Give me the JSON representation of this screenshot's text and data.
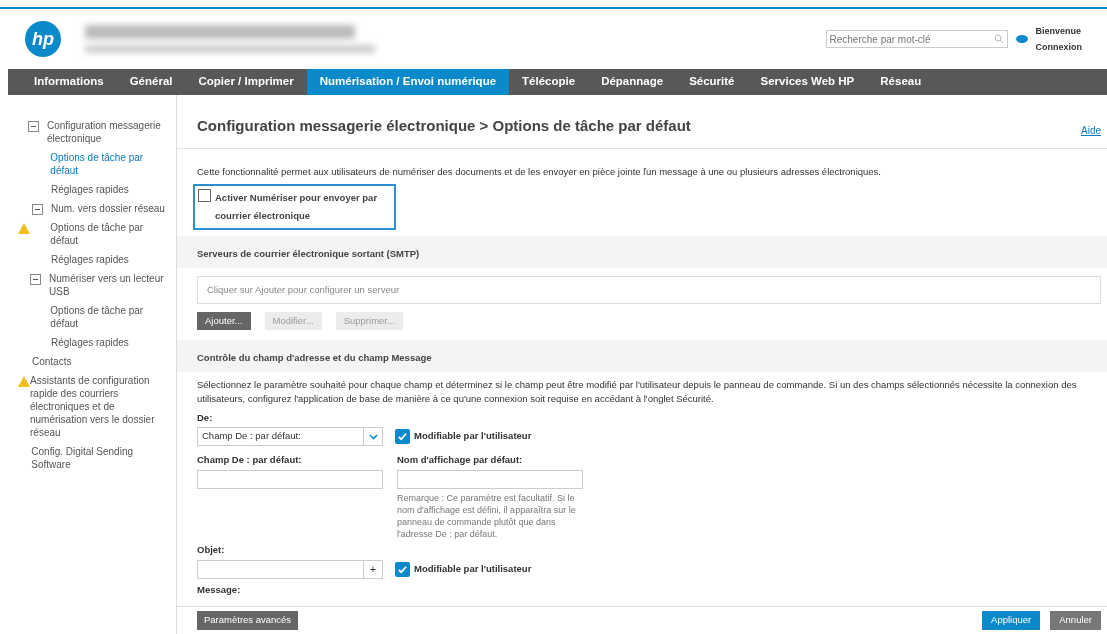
{
  "header": {
    "logo": "hp",
    "search": {
      "placeholder": "Recherche par mot-clé"
    },
    "welcome": "Bienvenue",
    "login": "Connexion"
  },
  "nav": [
    {
      "label": "Informations",
      "selected": false
    },
    {
      "label": "Général",
      "selected": false
    },
    {
      "label": "Copier / Imprimer",
      "selected": false
    },
    {
      "label": "Numérisation / Envoi numérique",
      "selected": true
    },
    {
      "label": "Télécopie",
      "selected": false
    },
    {
      "label": "Dépannage",
      "selected": false
    },
    {
      "label": "Sécurité",
      "selected": false
    },
    {
      "label": "Services Web HP",
      "selected": false
    },
    {
      "label": "Réseau",
      "selected": false
    }
  ],
  "sidebar": {
    "items": [
      {
        "label": "Configuration messagerie électronique",
        "expanded": true,
        "selected": false,
        "warning": false,
        "children": [
          {
            "label": "Options de tâche par défaut",
            "selected": true,
            "warning": false
          },
          {
            "label": "Réglages rapides",
            "selected": false,
            "warning": false
          }
        ]
      },
      {
        "label": "Num. vers dossier réseau",
        "expanded": true,
        "selected": false,
        "warning": false,
        "children": [
          {
            "label": "Options de tâche par défaut",
            "selected": false,
            "warning": true
          },
          {
            "label": "Réglages rapides",
            "selected": false,
            "warning": false
          }
        ]
      },
      {
        "label": "Numériser vers un lecteur USB",
        "expanded": true,
        "selected": false,
        "warning": false,
        "children": [
          {
            "label": "Options de tâche par défaut",
            "selected": false,
            "warning": false
          },
          {
            "label": "Réglages rapides",
            "selected": false,
            "warning": false
          }
        ]
      },
      {
        "label": "Contacts",
        "selected": false,
        "warning": false
      },
      {
        "label": "Assistants de configuration rapide des courriers électroniques et de numérisation vers le dossier réseau",
        "selected": false,
        "warning": true
      },
      {
        "label": "Config. Digital Sending Software",
        "selected": false,
        "warning": false
      }
    ]
  },
  "page": {
    "title": "Configuration messagerie électronique > Options de tâche par défaut",
    "help": "Aide",
    "description": "Cette fonctionnalité permet aux utilisateurs de numériser des documents et de les envoyer en pièce jointe ľun message à une ou plusieurs adresses électroniques.",
    "enable": {
      "label": "Activer Numériser pour envoyer par courrier électronique",
      "checked": false,
      "highlighted": true
    },
    "smtp": {
      "heading": "Serveurs de courrier électronique sortant (SMTP)",
      "list_placeholder": "Cliquer sur Ajouter pour configurer un serveur",
      "buttons": [
        {
          "label": "Ajouter...",
          "disabled": false
        },
        {
          "label": "Modifier...",
          "disabled": true
        },
        {
          "label": "Supprimer...",
          "disabled": true
        }
      ]
    },
    "address": {
      "heading": "Contrôle du champ d'adresse et du champ Message",
      "text": "Sélectionnez le paramètre souhaité pour chaque champ et déterminez si le champ peut être modifié par l'utilisateur depuis le panneau de commande. Si un des champs sélectionnés nécessite la connexion des utilisateurs, configurez l'application de base de manière à ce qu'une connexion soit requise en accédant à l'onglet Sécurité.",
      "from_label": "De:",
      "from_value": "Champ De : par défaut:",
      "from_editable": {
        "label": "Modifiable par l'utilisateur",
        "checked": true
      },
      "default_from_label": "Champ De : par défaut:",
      "display_name_label": "Nom d'affichage par défaut:",
      "note": "Remarque : Ce paramètre est facultatif. Si le nom d'affichage est défini, il apparaîtra sur le panneau de commande plutôt que dans l'adresse De : par défaut.",
      "subject_label": "Objet:",
      "subject_add": "+",
      "subject_editable": {
        "label": "Modifiable par l'utilisateur",
        "checked": true
      },
      "message_label": "Message:"
    }
  },
  "footer": {
    "advanced": "Paramètres avancés",
    "apply": "Appliquer",
    "cancel": "Annuler"
  }
}
